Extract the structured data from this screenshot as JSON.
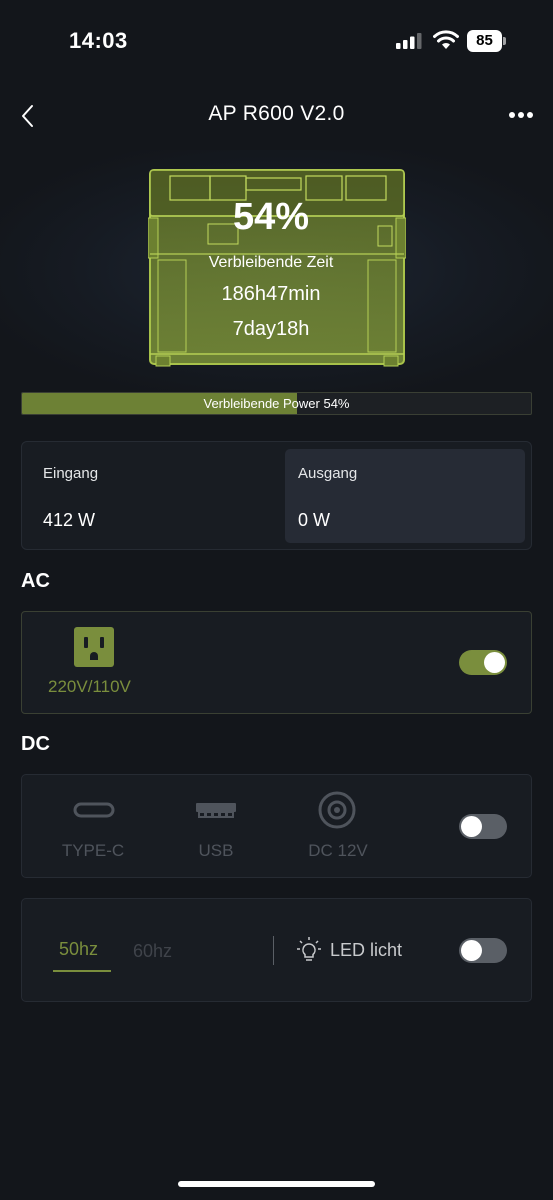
{
  "status_bar": {
    "time": "14:03",
    "battery_level": "85"
  },
  "nav": {
    "title": "AP R600 V2.0"
  },
  "hero": {
    "percent": "54%",
    "remaining_label": "Verbleibende Zeit",
    "remaining_hours": "186h47min",
    "remaining_days": "7day18h"
  },
  "power_bar": {
    "label": "Verbleibende Power 54%",
    "fill_fraction": 0.54
  },
  "io": {
    "input": {
      "label": "Eingang",
      "value": "412 W"
    },
    "output": {
      "label": "Ausgang",
      "value": "0 W"
    }
  },
  "ac": {
    "heading": "AC",
    "label": "220V/110V",
    "toggle_on": true
  },
  "dc": {
    "heading": "DC",
    "items": [
      {
        "label": "TYPE-C",
        "icon": "usb-c-icon"
      },
      {
        "label": "USB",
        "icon": "usb-a-icon"
      },
      {
        "label": "DC 12V",
        "icon": "dc-port-icon"
      }
    ],
    "toggle_on": false
  },
  "settings": {
    "freq_50": "50hz",
    "freq_60": "60hz",
    "selected_freq": "50hz",
    "led_label": "LED licht",
    "led_toggle_on": false
  },
  "colors": {
    "accent": "#7a8e3d",
    "background": "#13161b",
    "card": "#181c22"
  }
}
